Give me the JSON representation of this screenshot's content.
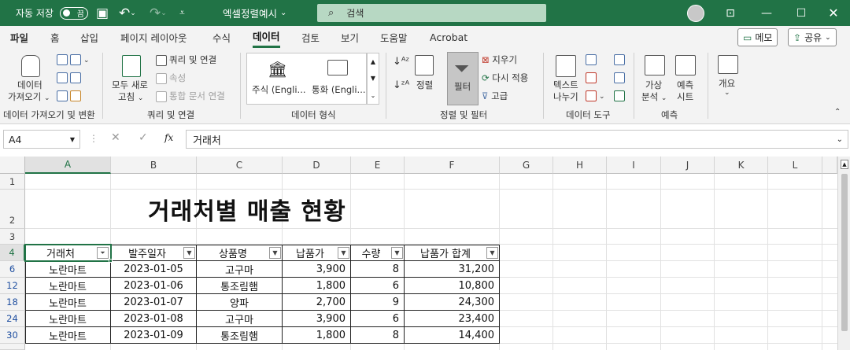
{
  "titlebar": {
    "autosave_label": "자동 저장",
    "autosave_state": "끔",
    "filename": "엑셀정렬예시",
    "search_placeholder": "검색"
  },
  "tabs": [
    "파일",
    "홈",
    "삽입",
    "페이지 레이아웃",
    "수식",
    "데이터",
    "검토",
    "보기",
    "도움말",
    "Acrobat"
  ],
  "active_tab": "데이터",
  "top_buttons": {
    "memo": "메모",
    "share": "공유"
  },
  "ribbon": {
    "get_data": {
      "label1": "데이터",
      "label2": "가져오기",
      "group": "데이터 가져오기 및 변환"
    },
    "refresh": {
      "label1": "모두 새로",
      "label2": "고침",
      "queries": "쿼리 및 연결",
      "properties": "속성",
      "edit_links": "통합 문서 연결",
      "group": "쿼리 및 연결"
    },
    "data_types": {
      "stocks": "주식 (Engli...",
      "currency": "통화 (Engli...",
      "group": "데이터 형식"
    },
    "sort_filter": {
      "sort": "정렬",
      "filter": "필터",
      "clear": "지우기",
      "reapply": "다시 적용",
      "advanced": "고급",
      "group": "정렬 및 필터"
    },
    "data_tools": {
      "text_to_col1": "텍스트",
      "text_to_col2": "나누기",
      "group": "데이터 도구"
    },
    "forecast": {
      "whatif1": "가상",
      "whatif2": "분석",
      "sheet1": "예측",
      "sheet2": "시트",
      "group": "예측"
    },
    "outline": {
      "label": "개요"
    }
  },
  "formula_bar": {
    "name_box": "A4",
    "fx": "fx",
    "content": "거래처"
  },
  "columns": [
    "A",
    "B",
    "C",
    "D",
    "E",
    "F",
    "G",
    "H",
    "I",
    "J",
    "K",
    "L"
  ],
  "rows": [
    "1",
    "2",
    "3",
    "4",
    "6",
    "12",
    "18",
    "24",
    "30"
  ],
  "sheet": {
    "title": "거래처별 매출 현황",
    "headers": [
      "거래처",
      "발주일자",
      "상품명",
      "납품가",
      "수량",
      "납품가 합계"
    ],
    "data": [
      [
        "노란마트",
        "2023-01-05",
        "고구마",
        "3,900",
        "8",
        "31,200"
      ],
      [
        "노란마트",
        "2023-01-06",
        "통조림햄",
        "1,800",
        "6",
        "10,800"
      ],
      [
        "노란마트",
        "2023-01-07",
        "양파",
        "2,700",
        "9",
        "24,300"
      ],
      [
        "노란마트",
        "2023-01-08",
        "고구마",
        "3,900",
        "6",
        "23,400"
      ],
      [
        "노란마트",
        "2023-01-09",
        "통조림햄",
        "1,800",
        "8",
        "14,400"
      ]
    ]
  },
  "colors": {
    "accent": "#217346",
    "filtered_row_number": "#1f4fa0"
  }
}
